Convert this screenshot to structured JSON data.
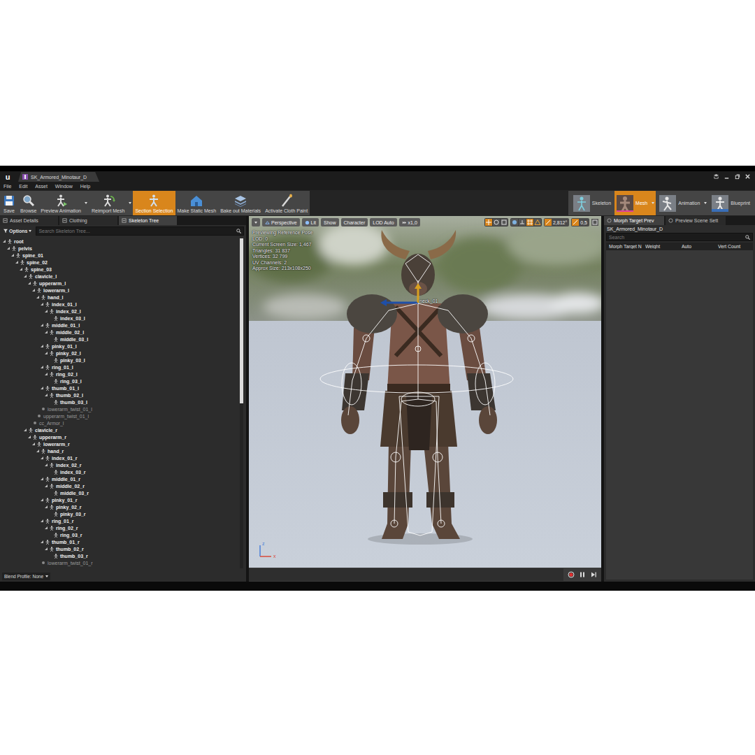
{
  "window": {
    "logo": "u",
    "title": "SK_Armored_Minotaur_D"
  },
  "menu": [
    "File",
    "Edit",
    "Asset",
    "Window",
    "Help"
  ],
  "toolbar": [
    {
      "label": "Save",
      "selected": false,
      "dropdown": false
    },
    {
      "label": "Browse",
      "selected": false,
      "dropdown": false
    },
    {
      "label": "Preview Animation",
      "selected": false,
      "dropdown": true
    },
    {
      "label": "Reimport Mesh",
      "selected": false,
      "dropdown": true
    },
    {
      "label": "Section Selection",
      "selected": true,
      "dropdown": false
    },
    {
      "label": "Make Static Mesh",
      "selected": false,
      "dropdown": false
    },
    {
      "label": "Bake out Materials",
      "selected": false,
      "dropdown": false
    },
    {
      "label": "Activate Cloth Paint",
      "selected": false,
      "dropdown": false
    }
  ],
  "modes": [
    {
      "label": "Skeleton",
      "selected": false,
      "dropdown": false
    },
    {
      "label": "Mesh",
      "selected": true,
      "dropdown": true
    },
    {
      "label": "Animation",
      "selected": false,
      "dropdown": true
    },
    {
      "label": "Blueprint",
      "selected": false,
      "dropdown": false
    }
  ],
  "left_panel": {
    "tabs": [
      {
        "label": "Asset Details",
        "selected": false
      },
      {
        "label": "Clothing",
        "selected": false
      },
      {
        "label": "Skeleton Tree",
        "selected": true
      }
    ],
    "options": "Options",
    "search_placeholder": "Search Skeleton Tree...",
    "scrollbar": {
      "level": 0.5
    },
    "tree": [
      {
        "label": "root",
        "depth": 0,
        "kind": "branch",
        "expanded": true
      },
      {
        "label": "pelvis",
        "depth": 1,
        "kind": "branch",
        "expanded": true
      },
      {
        "label": "spine_01",
        "depth": 2,
        "kind": "branch",
        "expanded": true
      },
      {
        "label": "spine_02",
        "depth": 3,
        "kind": "branch",
        "expanded": true
      },
      {
        "label": "spine_03",
        "depth": 4,
        "kind": "branch",
        "expanded": true
      },
      {
        "label": "clavicle_l",
        "depth": 5,
        "kind": "branch",
        "expanded": true
      },
      {
        "label": "upperarm_l",
        "depth": 6,
        "kind": "branch",
        "expanded": true
      },
      {
        "label": "lowerarm_l",
        "depth": 7,
        "kind": "branch",
        "expanded": true
      },
      {
        "label": "hand_l",
        "depth": 8,
        "kind": "branch",
        "expanded": true
      },
      {
        "label": "index_01_l",
        "depth": 9,
        "kind": "branch",
        "expanded": true
      },
      {
        "label": "index_02_l",
        "depth": 10,
        "kind": "branch",
        "expanded": true
      },
      {
        "label": "index_03_l",
        "depth": 11,
        "kind": "leaf",
        "expanded": false
      },
      {
        "label": "middle_01_l",
        "depth": 9,
        "kind": "branch",
        "expanded": true
      },
      {
        "label": "middle_02_l",
        "depth": 10,
        "kind": "branch",
        "expanded": true
      },
      {
        "label": "middle_03_l",
        "depth": 11,
        "kind": "leaf",
        "expanded": false
      },
      {
        "label": "pinky_01_l",
        "depth": 9,
        "kind": "branch",
        "expanded": true
      },
      {
        "label": "pinky_02_l",
        "depth": 10,
        "kind": "branch",
        "expanded": true
      },
      {
        "label": "pinky_03_l",
        "depth": 11,
        "kind": "leaf",
        "expanded": false
      },
      {
        "label": "ring_01_l",
        "depth": 9,
        "kind": "branch",
        "expanded": true
      },
      {
        "label": "ring_02_l",
        "depth": 10,
        "kind": "branch",
        "expanded": true
      },
      {
        "label": "ring_03_l",
        "depth": 11,
        "kind": "leaf",
        "expanded": false
      },
      {
        "label": "thumb_01_l",
        "depth": 9,
        "kind": "branch",
        "expanded": true
      },
      {
        "label": "thumb_02_l",
        "depth": 10,
        "kind": "branch",
        "expanded": true
      },
      {
        "label": "thumb_03_l",
        "depth": 11,
        "kind": "leaf",
        "expanded": false
      },
      {
        "label": "lowerarm_twist_01_l",
        "depth": 8,
        "kind": "virtual",
        "expanded": false
      },
      {
        "label": "upperarm_twist_01_l",
        "depth": 7,
        "kind": "virtual",
        "expanded": false
      },
      {
        "label": "cc_Armor_l",
        "depth": 6,
        "kind": "virtual",
        "expanded": false
      },
      {
        "label": "clavicle_r",
        "depth": 5,
        "kind": "branch",
        "expanded": true
      },
      {
        "label": "upperarm_r",
        "depth": 6,
        "kind": "branch",
        "expanded": true
      },
      {
        "label": "lowerarm_r",
        "depth": 7,
        "kind": "branch",
        "expanded": true
      },
      {
        "label": "hand_r",
        "depth": 8,
        "kind": "branch",
        "expanded": true
      },
      {
        "label": "index_01_r",
        "depth": 9,
        "kind": "branch",
        "expanded": true
      },
      {
        "label": "index_02_r",
        "depth": 10,
        "kind": "branch",
        "expanded": true
      },
      {
        "label": "index_03_r",
        "depth": 11,
        "kind": "leaf",
        "expanded": false
      },
      {
        "label": "middle_01_r",
        "depth": 9,
        "kind": "branch",
        "expanded": true
      },
      {
        "label": "middle_02_r",
        "depth": 10,
        "kind": "branch",
        "expanded": true
      },
      {
        "label": "middle_03_r",
        "depth": 11,
        "kind": "leaf",
        "expanded": false
      },
      {
        "label": "pinky_01_r",
        "depth": 9,
        "kind": "branch",
        "expanded": true
      },
      {
        "label": "pinky_02_r",
        "depth": 10,
        "kind": "branch",
        "expanded": true
      },
      {
        "label": "pinky_03_r",
        "depth": 11,
        "kind": "leaf",
        "expanded": false
      },
      {
        "label": "ring_01_r",
        "depth": 9,
        "kind": "branch",
        "expanded": true
      },
      {
        "label": "ring_02_r",
        "depth": 10,
        "kind": "branch",
        "expanded": true
      },
      {
        "label": "ring_03_r",
        "depth": 11,
        "kind": "leaf",
        "expanded": false
      },
      {
        "label": "thumb_01_r",
        "depth": 9,
        "kind": "branch",
        "expanded": true
      },
      {
        "label": "thumb_02_r",
        "depth": 10,
        "kind": "branch",
        "expanded": true
      },
      {
        "label": "thumb_03_r",
        "depth": 11,
        "kind": "leaf",
        "expanded": false
      },
      {
        "label": "lowerarm_twist_01_r",
        "depth": 8,
        "kind": "virtual",
        "expanded": false
      }
    ],
    "footer": "Blend Profile: None"
  },
  "viewport": {
    "buttons": [
      {
        "label": "Perspective",
        "selected": false
      },
      {
        "label": "Lit",
        "selected": false
      },
      {
        "label": "Show",
        "selected": false
      },
      {
        "label": "Character",
        "selected": false
      },
      {
        "label": "LOD Auto",
        "selected": false
      },
      {
        "label": "x1,0",
        "selected": false
      }
    ],
    "snaps": [
      "2,812°",
      "0,5"
    ],
    "info": [
      "Previewing Reference Pose",
      "LOD: 0",
      "Current Screen Size: 1,467",
      "Triangles: 31 837",
      "Vertices: 32 799",
      "UV Channels: 2",
      "Approx Size: 213x108x250"
    ],
    "bone_label": "neck_01",
    "axes": [
      "z",
      "x"
    ]
  },
  "right_panel": {
    "tabs": [
      {
        "label": "Morph Target Prev",
        "selected": true
      },
      {
        "label": "Preview Scene Sett",
        "selected": false
      }
    ],
    "asset": "SK_Armored_Minotaur_D",
    "search_placeholder": "Search",
    "columns": [
      "Morph Target N",
      "Weight",
      "Auto",
      "Vert Count"
    ]
  }
}
